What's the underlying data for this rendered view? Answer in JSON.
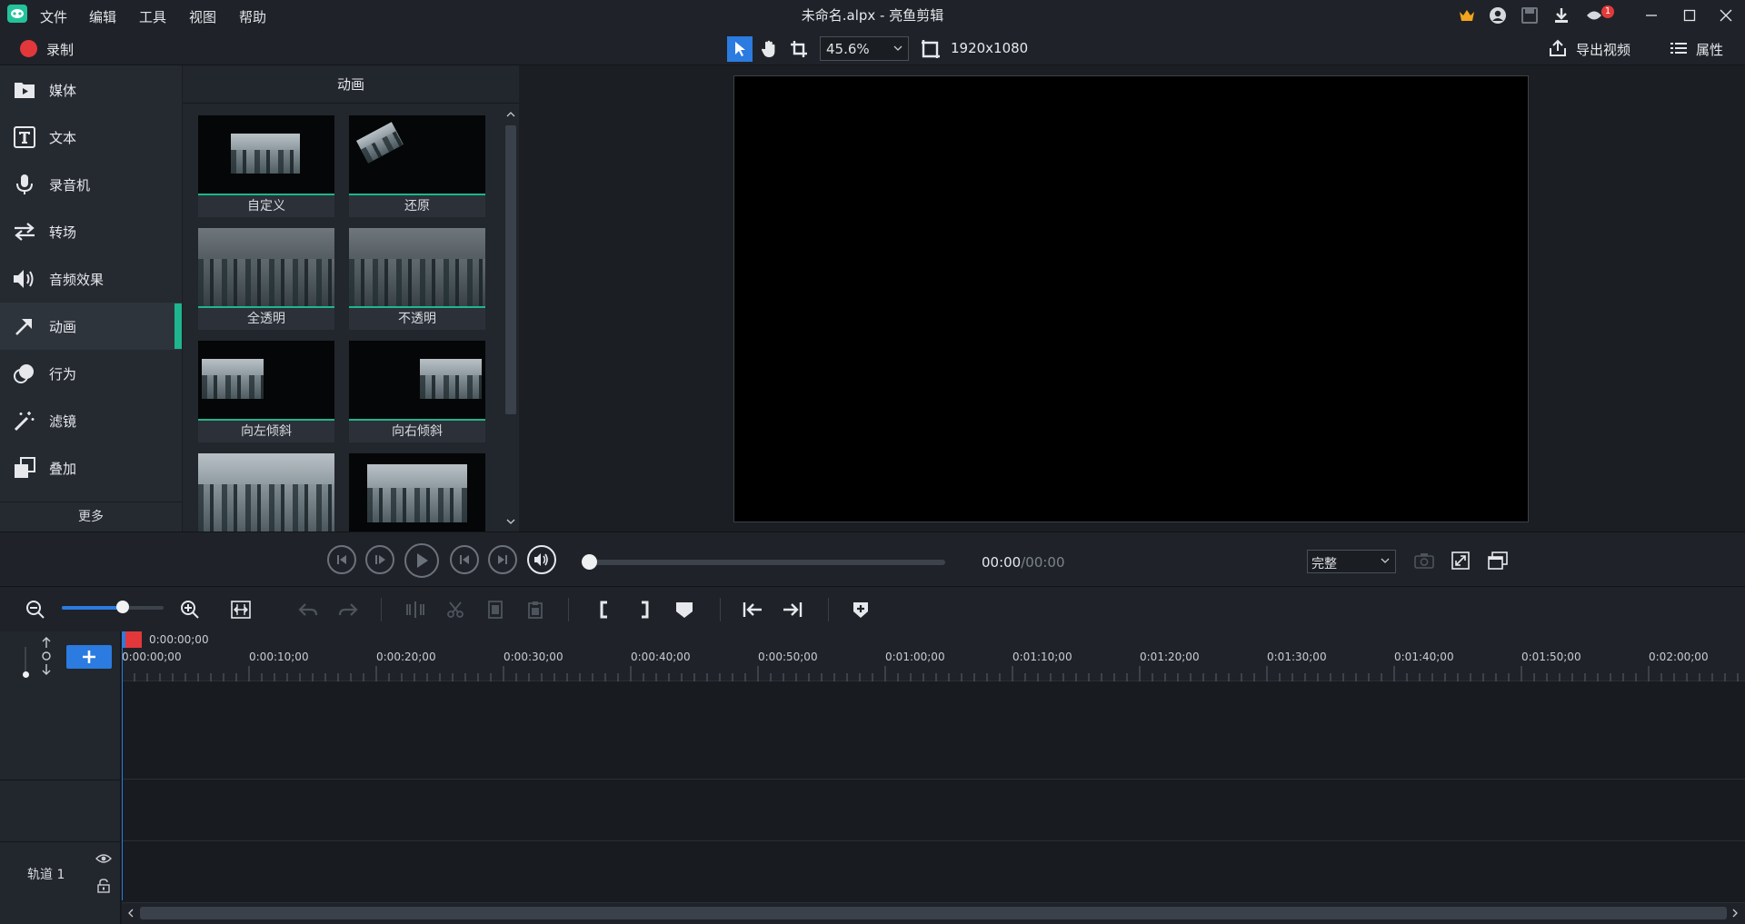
{
  "window": {
    "title": "未命名.alpx - 亮鱼剪辑",
    "menu": [
      "文件",
      "编辑",
      "工具",
      "视图",
      "帮助"
    ],
    "notification_count": "1"
  },
  "toolbar": {
    "record_label": "录制",
    "zoom_value": "45.6%",
    "resolution": "1920x1080",
    "export_label": "导出视频",
    "properties_label": "属性"
  },
  "sidebar": {
    "items": [
      {
        "label": "媒体",
        "icon": "media-folder-icon"
      },
      {
        "label": "文本",
        "icon": "text-icon"
      },
      {
        "label": "录音机",
        "icon": "microphone-icon"
      },
      {
        "label": "转场",
        "icon": "transition-arrows-icon"
      },
      {
        "label": "音频效果",
        "icon": "speaker-icon"
      },
      {
        "label": "动画",
        "icon": "animation-arrow-icon"
      },
      {
        "label": "行为",
        "icon": "behavior-icon"
      },
      {
        "label": "滤镜",
        "icon": "magic-wand-icon"
      },
      {
        "label": "叠加",
        "icon": "overlay-icon"
      }
    ],
    "active": "动画",
    "more_label": "更多"
  },
  "animation_panel": {
    "title": "动画",
    "tiles": [
      "自定义",
      "还原",
      "全透明",
      "不透明",
      "向左倾斜",
      "向右倾斜",
      "",
      ""
    ]
  },
  "playback": {
    "current_time": "00:00",
    "total_time": "/00:00",
    "quality": "完整",
    "progress": 0
  },
  "timeline": {
    "playhead_time": "0:00:00;00",
    "ticks": [
      "0:00:00;00",
      "0:00:10;00",
      "0:00:20;00",
      "0:00:30;00",
      "0:00:40;00",
      "0:00:50;00",
      "0:01:00;00",
      "0:01:10;00",
      "0:01:20;00",
      "0:01:30;00",
      "0:01:40;00",
      "0:01:50;00",
      "0:02:00;00"
    ],
    "track_label": "轨道 1",
    "zoom_level": 0.6
  },
  "colors": {
    "accent": "#2b7be0",
    "active_green": "#1fb58e",
    "record_red": "#e2383c"
  }
}
